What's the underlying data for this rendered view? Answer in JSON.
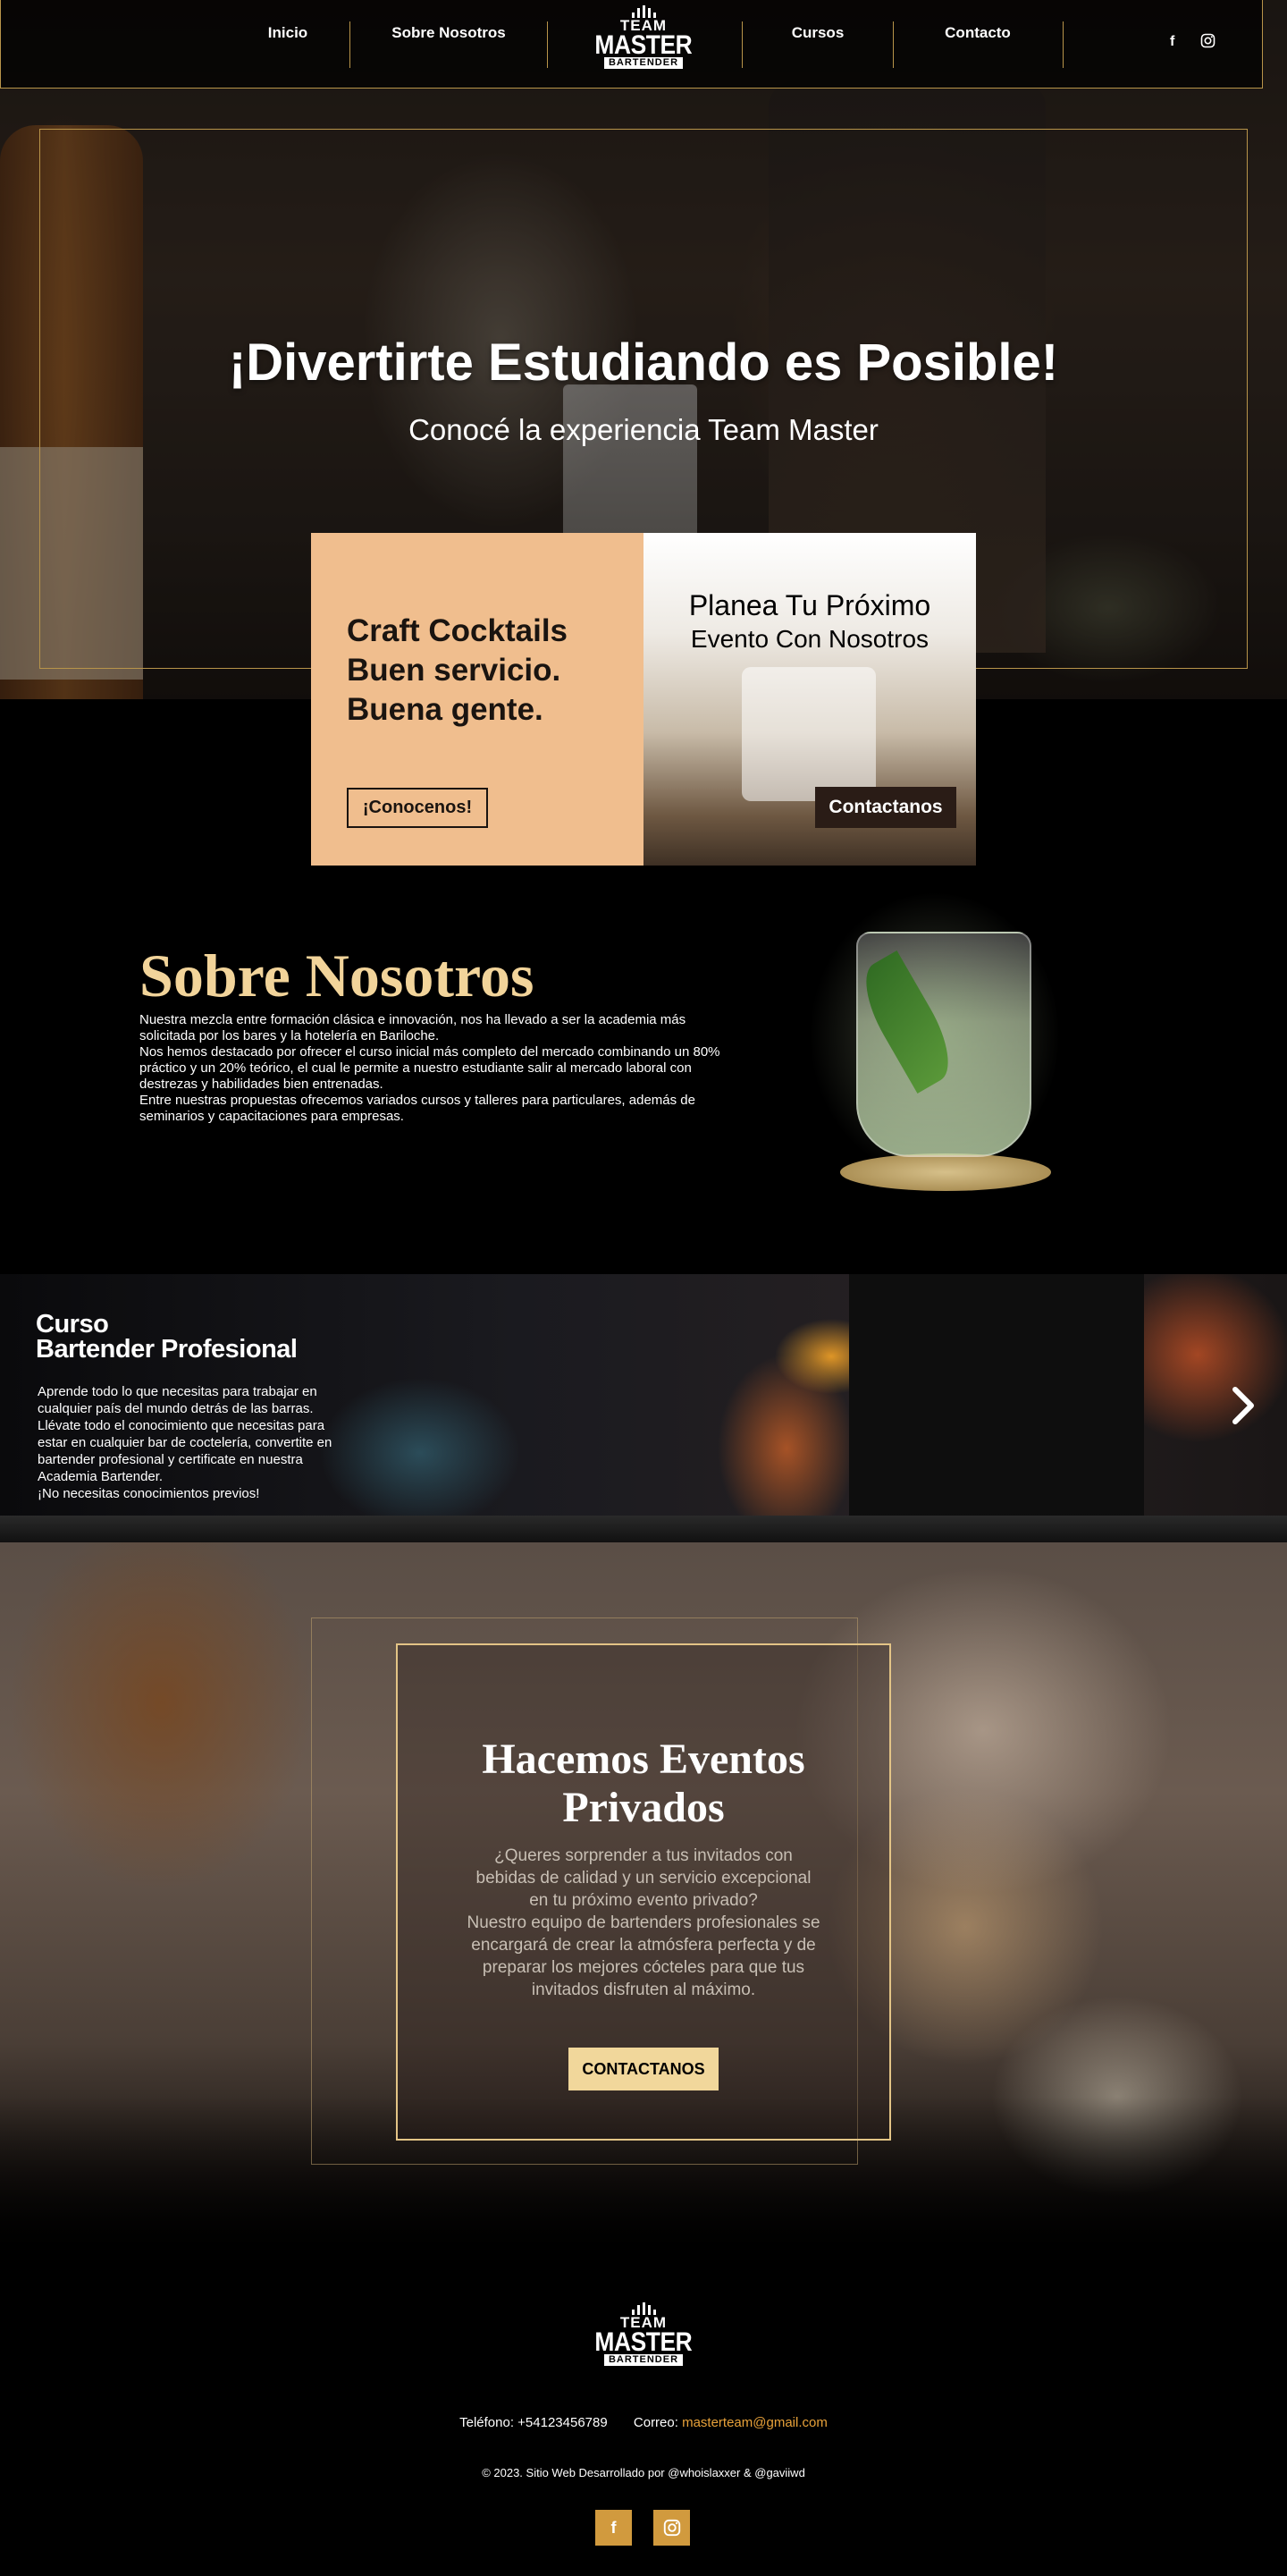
{
  "nav": {
    "items": [
      "Inicio",
      "Sobre Nosotros",
      "Cursos",
      "Contacto"
    ],
    "social_icons": [
      "facebook-icon",
      "instagram-icon"
    ]
  },
  "logo": {
    "line1": "TEAM",
    "line2": "MASTER",
    "line3": "BARTENDER"
  },
  "hero": {
    "title": "¡Divertirte Estudiando es Posible!",
    "subtitle": "Conocé la experiencia Team Master"
  },
  "promo": {
    "left_headline": [
      "Craft Cocktails",
      "Buen servicio.",
      "Buena gente."
    ],
    "left_button": "¡Conocenos!",
    "right_title_line1": "Planea Tu Próximo",
    "right_title_line2": "Evento Con Nosotros",
    "right_button": "Contactanos"
  },
  "about": {
    "title": "Sobre Nosotros",
    "paragraphs": [
      "Nuestra mezcla entre formación clásica e innovación, nos ha llevado a ser la academia más solicitada por los bares y la hotelería en Bariloche.",
      "Nos hemos destacado por ofrecer el curso inicial más completo del mercado combinando un 80% práctico y un 20% teórico, el cual le permite a nuestro estudiante salir al mercado laboral con destrezas y habilidades bien entrenadas.",
      "Entre nuestras propuestas ofrecemos variados cursos y talleres para particulares, además de seminarios y capacitaciones para empresas."
    ]
  },
  "course": {
    "title_line1": "Curso",
    "title_line2": "Bartender Profesional",
    "text": "Aprende todo lo que necesitas para trabajar en cualquier país del mundo detrás de las barras. Llévate todo el conocimiento que necesitas para estar en cualquier bar de coctelería, convertite en bartender profesional y certificate en nuestra Academia Bartender.",
    "text_last": "¡No necesitas conocimientos previos!",
    "next_icon": "chevron-right-icon"
  },
  "events": {
    "title": "Hacemos Eventos Privados",
    "text_q": "¿Queres sorprender a tus invitados con bebidas de calidad y un servicio excepcional en tu próximo evento privado?",
    "text_body": "Nuestro equipo de bartenders profesionales se encargará de crear la atmósfera perfecta y de preparar los mejores cócteles para que tus invitados disfruten al máximo.",
    "button": "CONTACTANOS"
  },
  "footer": {
    "phone_label": "Teléfono: +54123456789",
    "mail_label": "Correo: ",
    "mail": "masterteam@gmail.com",
    "copyright": "© 2023. Sitio Web Desarrollado por @whoislaxxer & @gaviiwd",
    "social_icons": [
      "facebook-icon",
      "instagram-icon"
    ],
    "accent_color": "#d19a3e"
  },
  "colors": {
    "gold": "#b8944a",
    "peach": "#f0be8e",
    "title_gold": "#f2d49a"
  }
}
